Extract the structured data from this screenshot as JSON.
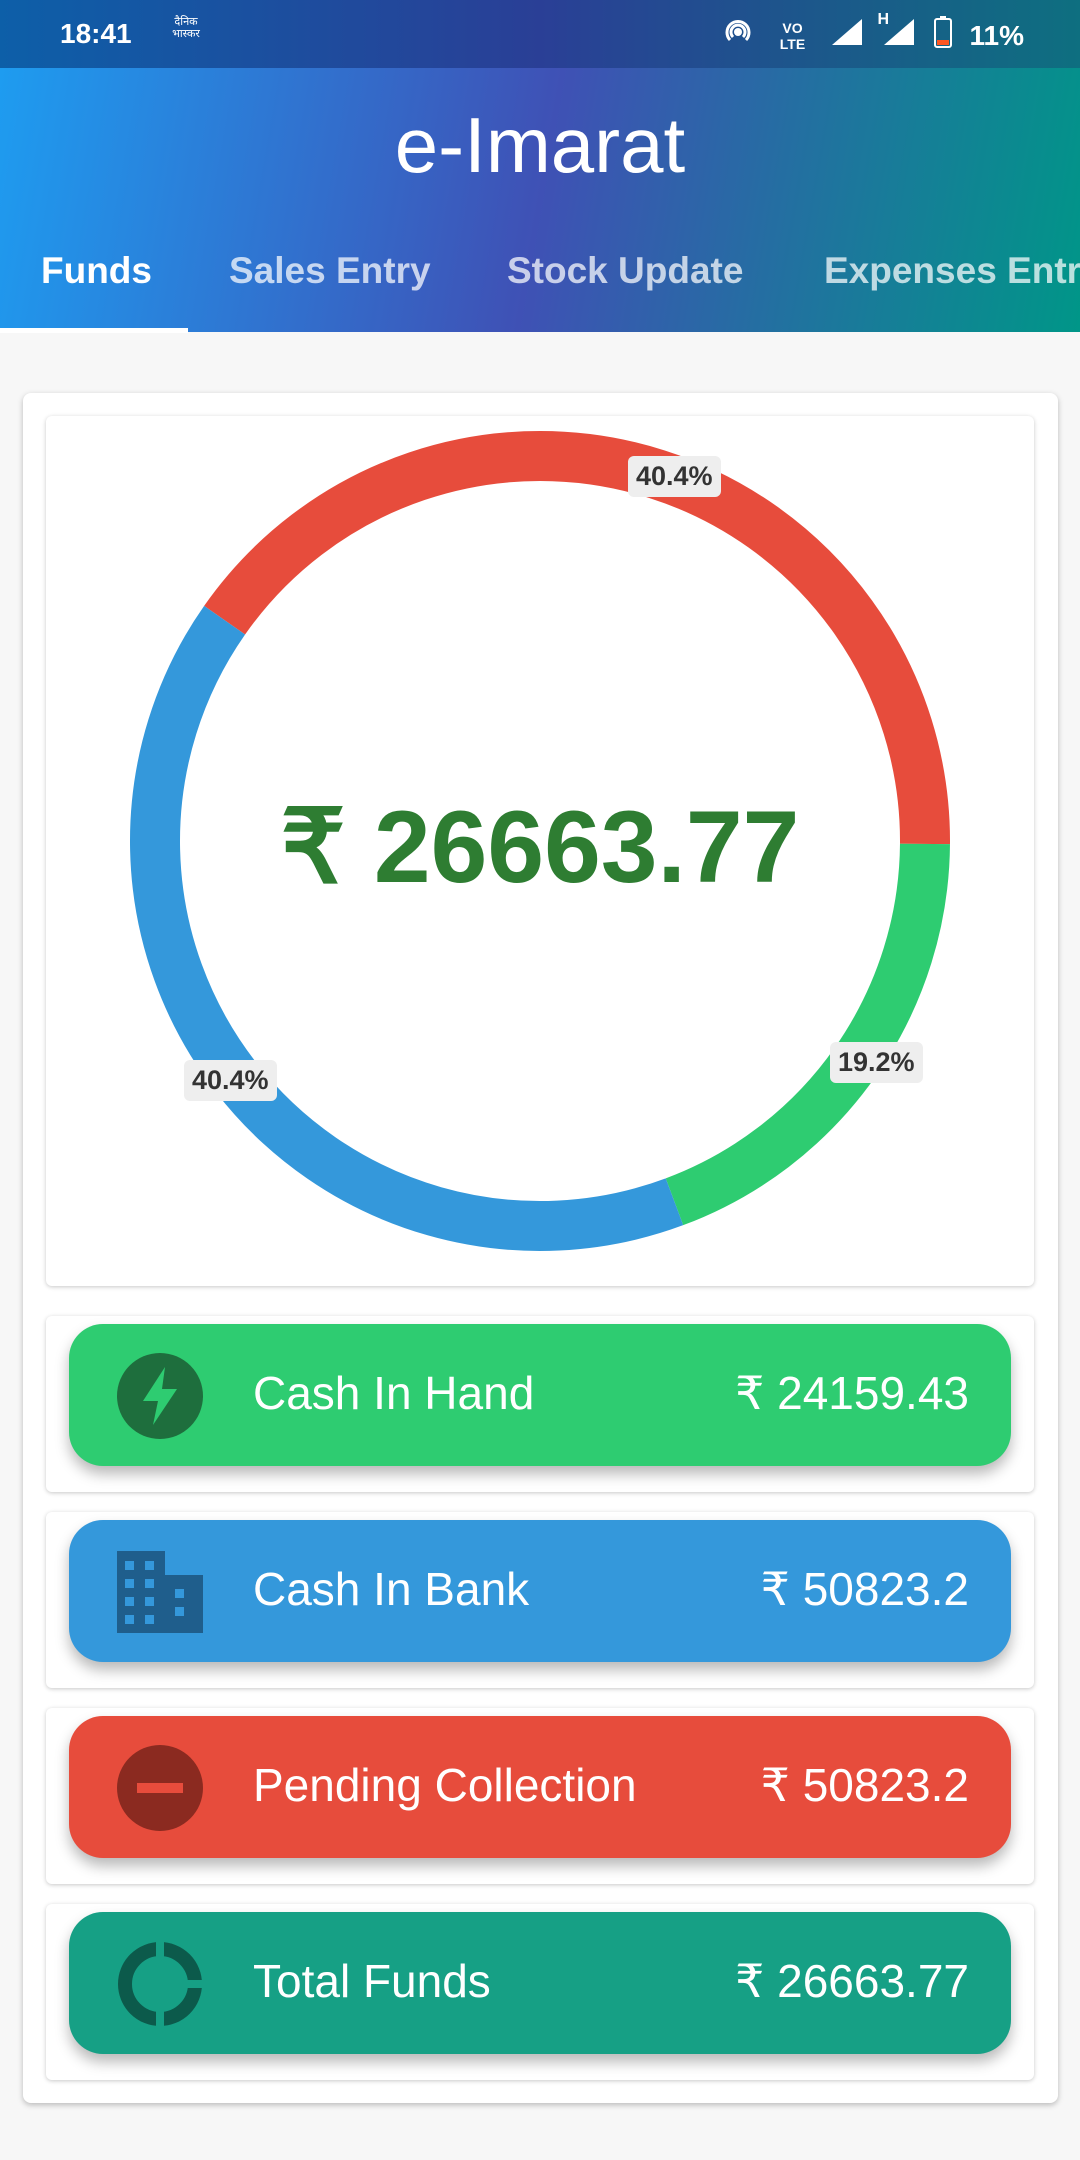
{
  "status_bar": {
    "time": "18:41",
    "app_badge": "दैनिक भास्कर",
    "icons": [
      "hotspot-icon",
      "volte-icon",
      "signal-icon",
      "signal-h-icon",
      "battery-icon"
    ],
    "volte": "VO LTE",
    "network": "H",
    "battery": "11%"
  },
  "app": {
    "title": "e-Imarat",
    "tabs": [
      "Funds",
      "Sales Entry",
      "Stock Update",
      "Expenses Entry"
    ],
    "active_tab": 0
  },
  "chart_data": {
    "type": "pie",
    "donut": true,
    "center_text": "₹ 26663.77",
    "slices": [
      {
        "label": "40.4%",
        "value": 40.4,
        "color": "#e74c3c"
      },
      {
        "label": "19.2%",
        "value": 19.2,
        "color": "#2ecc71"
      },
      {
        "label": "40.4%",
        "value": 40.4,
        "color": "#3498db"
      }
    ]
  },
  "rows": [
    {
      "label": "Cash In Hand",
      "value": "₹ 24159.43",
      "color": "#2ecc71",
      "icon": "lightning-icon",
      "icon_color": "#1e6e3d"
    },
    {
      "label": "Cash In Bank",
      "value": "₹ 50823.2",
      "color": "#3498db",
      "icon": "building-icon",
      "icon_color": "#1f5e8c"
    },
    {
      "label": "Pending Collection",
      "value": "₹ 50823.2",
      "color": "#e74c3c",
      "icon": "minus-circle-icon",
      "icon_color": "#8b2a20"
    },
    {
      "label": "Total Funds",
      "value": "₹ 26663.77",
      "color": "#16a085",
      "icon": "donut-icon",
      "icon_color": "#0c5a4b"
    }
  ]
}
